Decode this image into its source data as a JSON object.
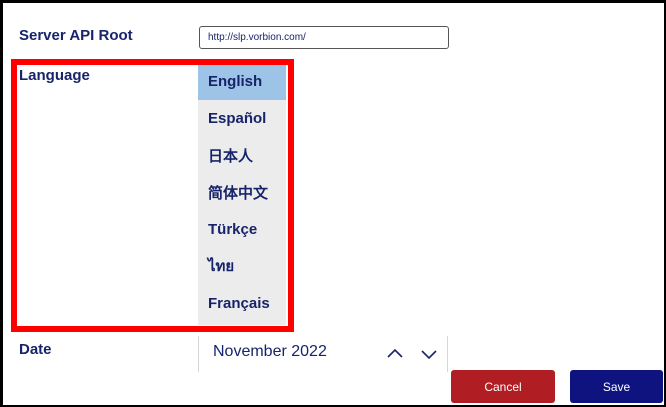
{
  "form": {
    "server_label": "Server API Root",
    "server_value": "http://slp.vorbion.com/",
    "language_label": "Language",
    "date_label": "Date"
  },
  "language_list": {
    "selected": "English",
    "options": [
      "English",
      "Español",
      "日本人",
      "简体中文",
      "Türkçe",
      "ไทย",
      "Français"
    ]
  },
  "date_picker": {
    "value": "November 2022",
    "up_icon": "chevron-up-icon",
    "down_icon": "chevron-down-icon"
  },
  "actions": {
    "cancel_label": "Cancel",
    "save_label": "Save"
  },
  "colors": {
    "label_text": "#17246b",
    "selected_row": "#9dc3e6",
    "list_background": "#ececec",
    "highlight_border": "#ff0000",
    "cancel_button": "#b01e24",
    "save_button": "#0e1380"
  }
}
